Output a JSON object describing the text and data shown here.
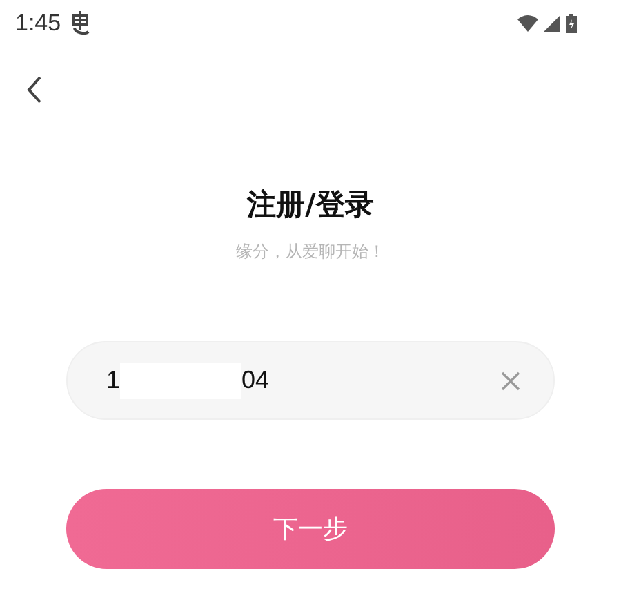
{
  "status_bar": {
    "time": "1:45"
  },
  "title": "注册/登录",
  "subtitle": "缘分，从爱聊开始！",
  "phone_field": {
    "value_parts": [
      "1",
      "04"
    ]
  },
  "next_button": {
    "label": "下一步"
  }
}
